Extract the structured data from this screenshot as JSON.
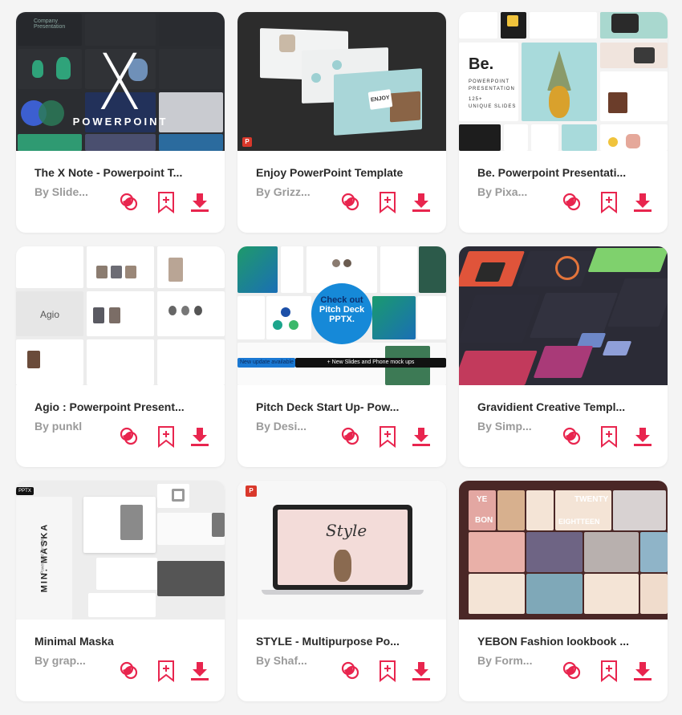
{
  "colors": {
    "accent": "#e8254e",
    "title_text": "#2a2a2a",
    "author_text": "#9a9a9a",
    "page_bg": "#f4f4f4"
  },
  "action_icons": [
    "compare-icon",
    "bookmark-add-icon",
    "download-icon"
  ],
  "cards": [
    {
      "title": "The X Note - Powerpoint T...",
      "author": "By Slide...",
      "thumbnail": {
        "big_letter": "X",
        "caption": "POWERPOINT",
        "corner_text": "Company Presentation"
      }
    },
    {
      "title": "Enjoy PowerPoint Template",
      "author": "By Grizz...",
      "thumbnail": {
        "slide_text": "ENJOY",
        "badge": "P"
      }
    },
    {
      "title": "Be. Powerpoint Presentati...",
      "author": "By Pixa...",
      "thumbnail": {
        "heading": "Be.",
        "lines": [
          "POWERPOINT",
          "PRESENTATION",
          "125+",
          "UNIQUE SLIDES"
        ]
      }
    },
    {
      "title": "Agio : Powerpoint Present...",
      "author": "By punkl",
      "thumbnail": {
        "logo": "Agio"
      }
    },
    {
      "title": "Pitch Deck Start Up- Pow...",
      "author": "By Desi...",
      "thumbnail": {
        "bubble_lines": [
          "Check out",
          "Pitch Deck",
          "PPTX."
        ],
        "banner_left": "New update available",
        "banner_right": "+ New Slides and Phone mock ups"
      }
    },
    {
      "title": "Gravidient Creative Templ...",
      "author": "By Simp...",
      "thumbnail": {}
    },
    {
      "title": "Minimal Maska",
      "author": "By grap...",
      "thumbnail": {
        "tag": "PPTX",
        "vertical_text": "MIN. MASKA",
        "sub_text": "Powerpoint Template"
      }
    },
    {
      "title": "STYLE - Multipurpose Po...",
      "author": "By Shaf...",
      "thumbnail": {
        "script_text": "Style",
        "badge": "P"
      }
    },
    {
      "title": "YEBON Fashion lookbook ...",
      "author": "By Form...",
      "thumbnail": {
        "words": [
          "YE",
          "BON",
          "TWENTY",
          "EIGHTTEEN"
        ]
      }
    }
  ]
}
